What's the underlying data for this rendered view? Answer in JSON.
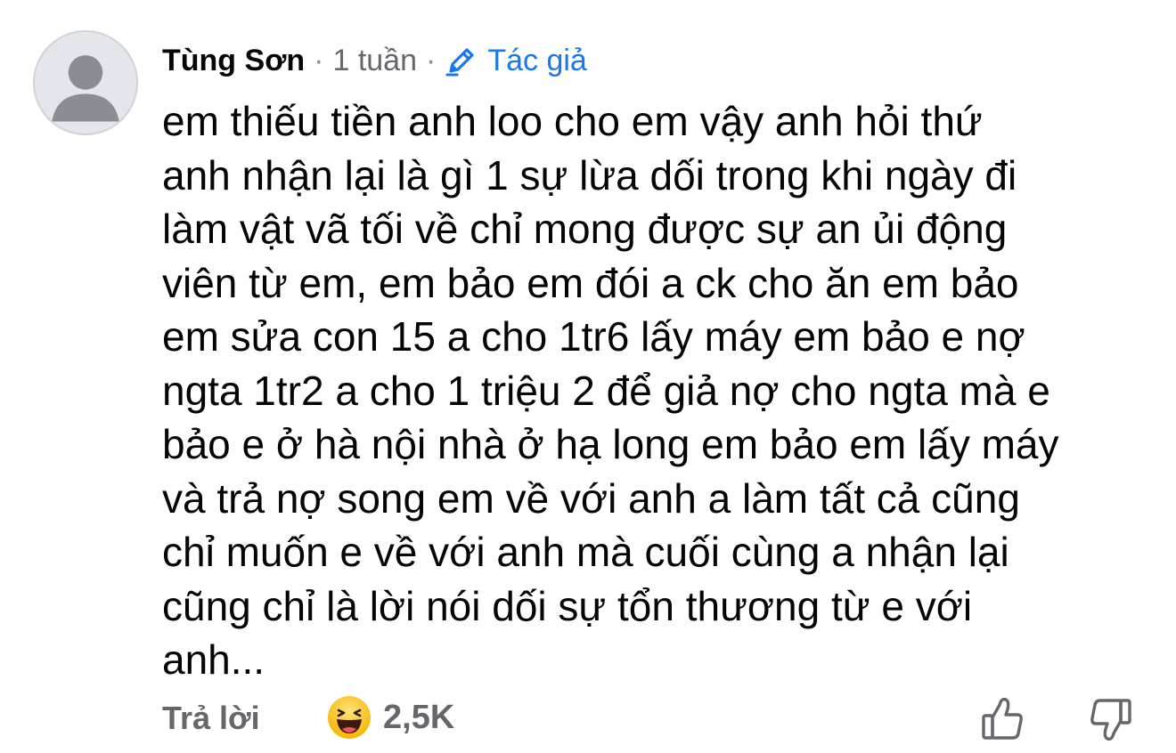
{
  "comment": {
    "author": "Tùng Sơn",
    "separator": "·",
    "time": "1 tuần",
    "author_badge_label": "Tác giả",
    "author_badge_icon": "pencil-icon",
    "text": "em thiếu tiền anh loo cho em vậy anh hỏi thứ\nanh nhận lại là gì 1 sự lừa dối trong khi ngày đi\nlàm vật vã tối về chỉ mong được sự an ủi động\nviên từ em, em bảo em đói a ck cho ăn em bảo\nem sửa con 15 a cho 1tr6 lấy máy em bảo e nợ\nngta 1tr2 a cho 1 triệu 2 để giả nợ cho ngta mà e\nbảo e ở hà nội nhà ở hạ long em bảo em lấy máy\nvà trả nợ song em về với anh a làm tất cả cũng\nchỉ muốn e về với anh mà cuối cùng a nhận lại\ncũng chỉ là lời nói dối sự tổn thương từ e với\nanh..."
  },
  "footer": {
    "reply_label": "Trả lời",
    "reaction_icon": "haha-emoji-icon",
    "reaction_count": "2,5K",
    "like_icon": "thumbs-up-icon",
    "dislike_icon": "thumbs-down-icon"
  },
  "colors": {
    "accent": "#1877f2",
    "secondary_text": "#65676b",
    "primary_text": "#050505",
    "avatar_bg": "#e4e6eb",
    "avatar_figure": "#8a8d91"
  }
}
